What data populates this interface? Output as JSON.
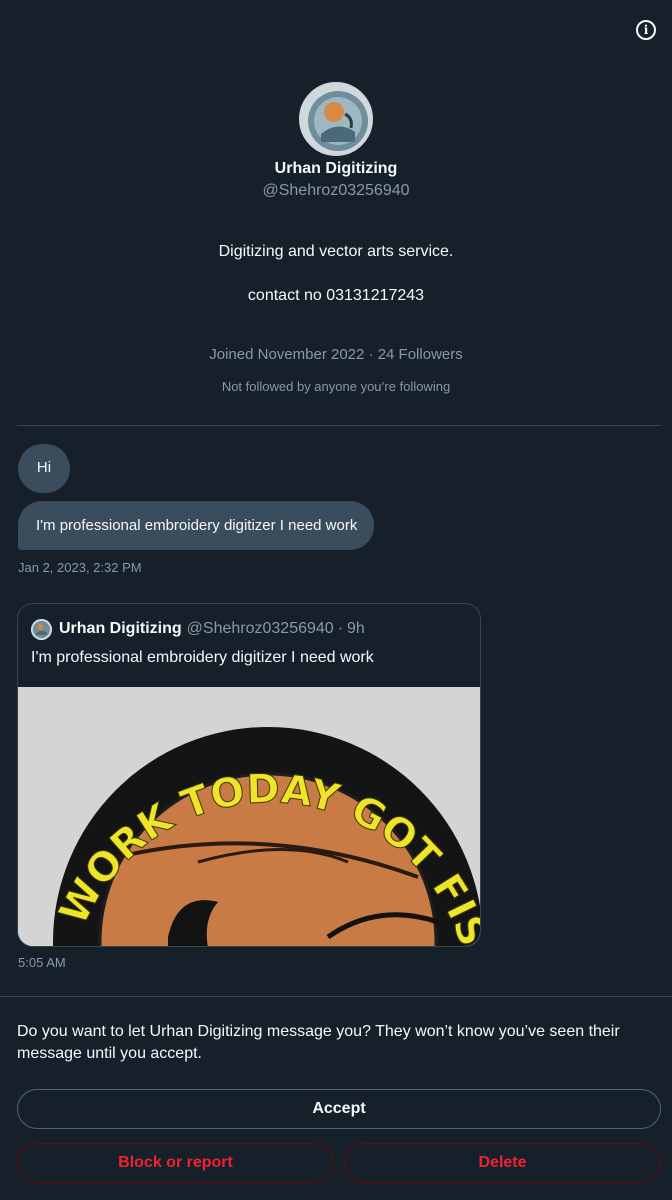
{
  "header": {
    "info_icon": "info-icon"
  },
  "profile": {
    "avatar_icon": "embroidery-patch-avatar",
    "display_name": "Urhan Digitizing",
    "handle": "@Shehroz03256940",
    "bio_line1": "Digitizing and vector arts service.",
    "bio_line2": "contact no 03131217243",
    "joined": "Joined November 2022",
    "separator": "·",
    "followers": "24 Followers",
    "followed_by": "Not followed by anyone you’re following"
  },
  "messages": {
    "hi": "Hi",
    "pitch": "I'm professional embroidery digitizer I need work",
    "timestamp_1": "Jan 2, 2023, 2:32 PM",
    "timestamp_2": "5:05 AM"
  },
  "quoted_tweet": {
    "name": "Urhan Digitizing",
    "handle": "@Shehroz03256940",
    "separator": "·",
    "time": "9h",
    "text": "I'm professional embroidery digitizer I need work",
    "image_text": "WORK TODAY GOT FISH TO"
  },
  "request": {
    "prompt": "Do you want to let Urhan Digitizing message you? They won’t know you’ve seen their message until you accept.",
    "accept_label": "Accept",
    "block_label": "Block or report",
    "delete_label": "Delete"
  },
  "colors": {
    "background": "#15202b",
    "bubble": "#3b4c5c",
    "muted_text": "#8b98a5",
    "danger": "#f4212e",
    "patch_text": "#f0e42a",
    "patch_fill": "#c97b45"
  }
}
